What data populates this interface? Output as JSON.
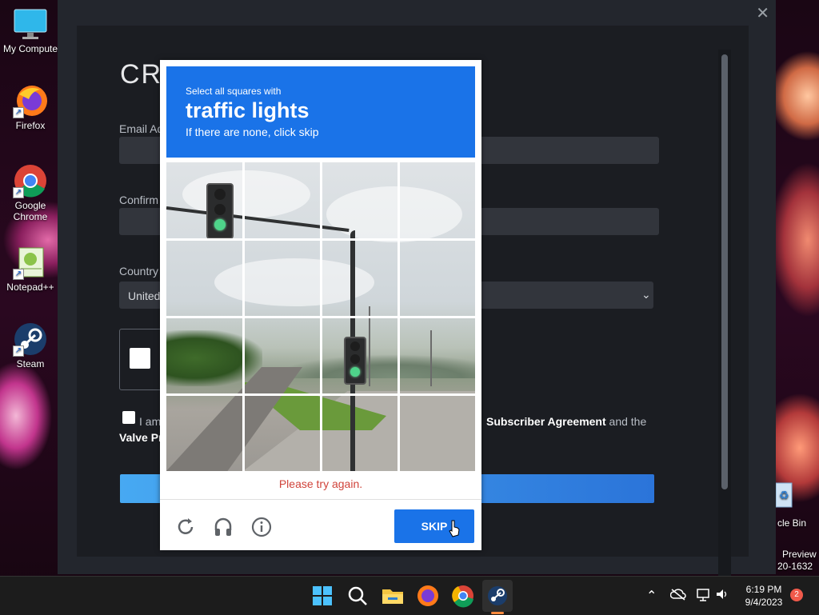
{
  "desktop": {
    "icons": [
      {
        "label": "My Compute"
      },
      {
        "label": "Firefox"
      },
      {
        "label": "Google Chrome"
      },
      {
        "label": "Notepad++"
      },
      {
        "label": "Steam"
      }
    ],
    "recycle_label": "cle Bin",
    "watermark_1": "Preview",
    "watermark_2": "20-1632"
  },
  "steam_form": {
    "close": "✕",
    "title_fragment": "CR",
    "email_label": "Email Ad",
    "confirm_label": "Confirm",
    "country_label": "Country",
    "country_value": "United",
    "agree_prefix": "I am",
    "agree_link1": "Subscriber Agreement",
    "agree_suffix": " and the",
    "agree_link2": "Valve Pr"
  },
  "captcha": {
    "instruction": "Select all squares with",
    "target": "traffic lights",
    "hint": "If there are none, click skip",
    "error": "Please try again.",
    "skip_label": "SKIP",
    "tools": [
      "reload-icon",
      "audio-icon",
      "info-icon"
    ]
  },
  "taskbar": {
    "apps": [
      "windows-start-icon",
      "search-icon",
      "file-explorer-icon",
      "firefox-icon",
      "chrome-icon",
      "steam-icon"
    ],
    "time": "6:19 PM",
    "date": "9/4/2023",
    "notification_count": "2",
    "colors": {
      "accent": "#1a73e8",
      "error": "#d0433a",
      "active_indicator": "#ff8a3d"
    }
  }
}
